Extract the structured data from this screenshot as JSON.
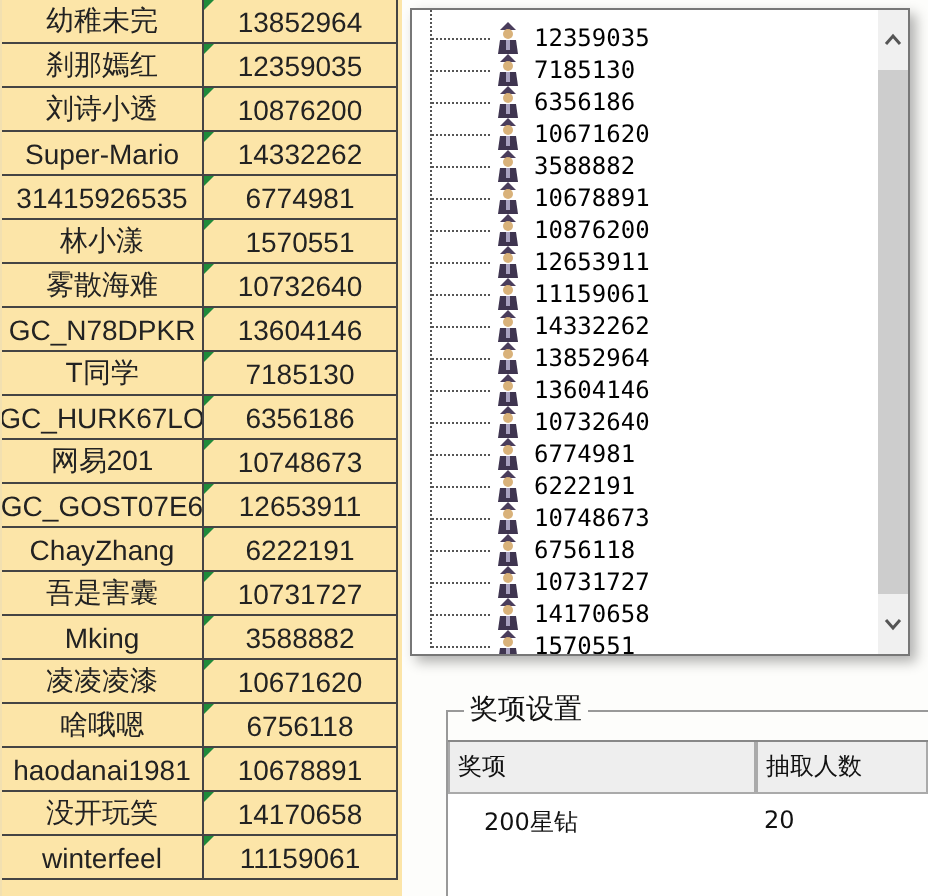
{
  "sheet": {
    "rows": [
      {
        "name": "幼稚未完",
        "id": "13852964"
      },
      {
        "name": "刹那嫣红",
        "id": "12359035"
      },
      {
        "name": "刘诗小透",
        "id": "10876200"
      },
      {
        "name": "Super-Mario",
        "id": "14332262"
      },
      {
        "name": "31415926535",
        "id": "6774981"
      },
      {
        "name": "林小漾",
        "id": "1570551"
      },
      {
        "name": "雾散海难",
        "id": "10732640"
      },
      {
        "name": "GC_N78DPKR",
        "id": "13604146"
      },
      {
        "name": "T同学",
        "id": "7185130"
      },
      {
        "name": "GC_HURK67LO",
        "id": "6356186"
      },
      {
        "name": "网易201",
        "id": "10748673"
      },
      {
        "name": "GC_GOST07E6",
        "id": "12653911"
      },
      {
        "name": "ChayZhang",
        "id": "6222191"
      },
      {
        "name": "吾是害囊",
        "id": "10731727"
      },
      {
        "name": "Mking",
        "id": "3588882"
      },
      {
        "name": "凌凌凌漆",
        "id": "10671620"
      },
      {
        "name": "啥哦嗯",
        "id": "6756118"
      },
      {
        "name": "haodanai1981",
        "id": "10678891"
      },
      {
        "name": "没开玩笑",
        "id": "14170658"
      },
      {
        "name": "winterfeel",
        "id": "11159061"
      }
    ]
  },
  "tree": {
    "items": [
      "12359035",
      "7185130",
      "6356186",
      "10671620",
      "3588882",
      "10678891",
      "10876200",
      "12653911",
      "11159061",
      "14332262",
      "13852964",
      "13604146",
      "10732640",
      "6774981",
      "6222191",
      "10748673",
      "6756118",
      "10731727",
      "14170658",
      "1570551"
    ]
  },
  "prize_settings": {
    "title": "奖项设置",
    "columns": [
      "奖项",
      "抽取人数"
    ],
    "rows": [
      [
        "200星钻",
        "20"
      ]
    ]
  }
}
